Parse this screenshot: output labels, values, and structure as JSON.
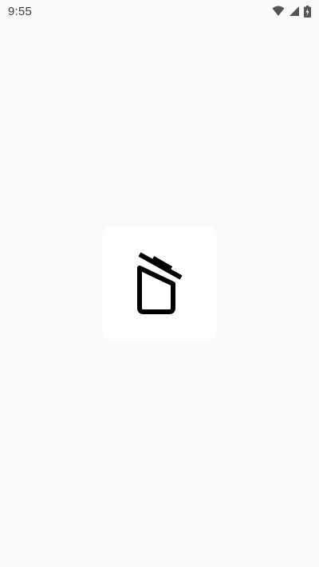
{
  "status_bar": {
    "time": "9:55",
    "icons": [
      "wifi-icon",
      "cellular-signal-icon",
      "battery-charging-icon"
    ]
  },
  "splash": {
    "icon": "trash-bin-open-lid-icon",
    "card_color": "#ffffff",
    "icon_color": "#000000"
  },
  "colors": {
    "background": "#fafafa",
    "status_text": "#3c3c3c"
  }
}
